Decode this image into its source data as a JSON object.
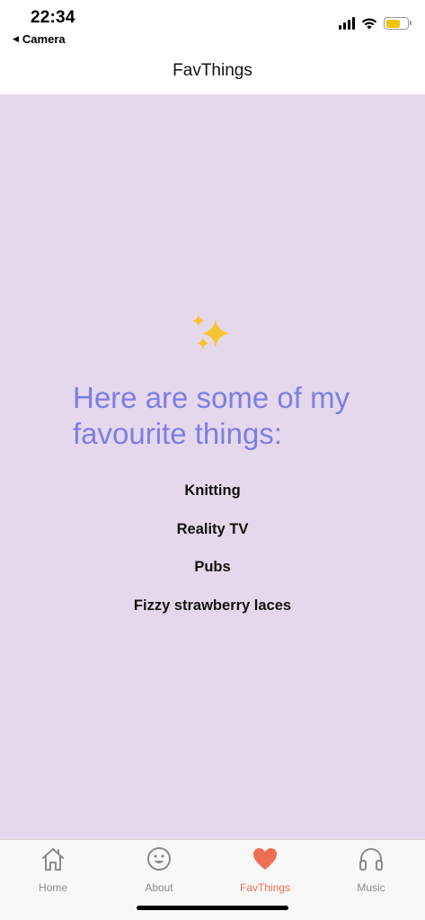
{
  "status_bar": {
    "time": "22:34",
    "back_app": "Camera",
    "back_arrow": "◀",
    "battery_color": "#f1c40f"
  },
  "nav": {
    "title": "FavThings"
  },
  "content": {
    "background": "#e6d8ec",
    "icon": "sparkles-icon",
    "heading": "Here are some of my favourite things:",
    "items": [
      "Knitting",
      "Reality TV",
      "Pubs",
      "Fizzy strawberry laces"
    ]
  },
  "tabs": [
    {
      "label": "Home",
      "icon": "house-icon",
      "active": false
    },
    {
      "label": "About",
      "icon": "smiley-icon",
      "active": false
    },
    {
      "label": "FavThings",
      "icon": "heart-icon",
      "active": true
    },
    {
      "label": "Music",
      "icon": "headphones-icon",
      "active": false
    }
  ],
  "colors": {
    "accent": "#ee6e55",
    "heading": "#7c7ee4",
    "inactive_tab": "#8a8a8a"
  }
}
